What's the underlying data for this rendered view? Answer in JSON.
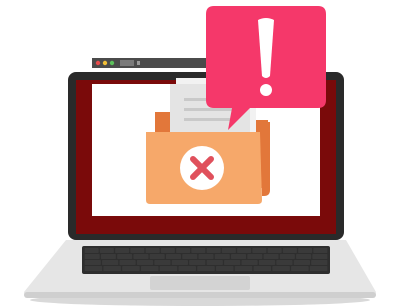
{
  "illustration": {
    "subject": "laptop-error-folder",
    "icons": [
      "laptop",
      "browser-window",
      "folder",
      "document",
      "error-x-icon",
      "alert-speech-bubble",
      "exclamation-icon"
    ],
    "colors": {
      "laptop_body": "#2a2a2a",
      "screen_frame": "#7a0a0a",
      "screen_inner": "#ffffff",
      "folder_back": "#e2773a",
      "folder_front": "#f6a86a",
      "error_circle": "#ffffff",
      "error_x": "#e0505c",
      "alert_bubble": "#f5386a",
      "alert_mark": "#ffffff",
      "keyboard_base": "#e6e6e6",
      "keys": "#2e2e2e"
    }
  }
}
